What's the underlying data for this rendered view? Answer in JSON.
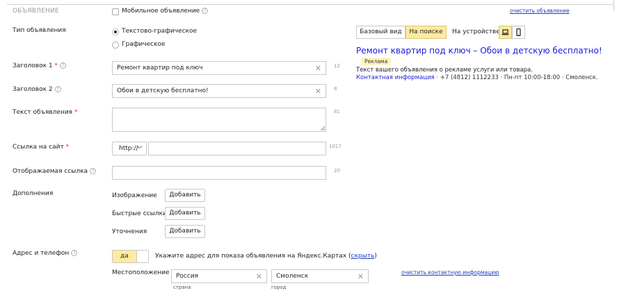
{
  "section": {
    "title": "ОБЪЯВЛЕНИЕ",
    "mobile_label": "Мобильное объявление",
    "mobile_checked": false,
    "clear_ad_link": "очистить объявление"
  },
  "ad_type": {
    "label": "Тип объявления",
    "options": [
      {
        "label": "Текстово-графическое",
        "selected": true
      },
      {
        "label": "Графическое",
        "selected": false
      }
    ]
  },
  "title1": {
    "label": "Заголовок 1",
    "value": "Ремонт квартир под ключ",
    "counter": "12"
  },
  "title2": {
    "label": "Заголовок 2",
    "value": "Обои в детскую бесплатно!",
    "counter": "8"
  },
  "ad_text": {
    "label": "Текст объявления",
    "value": "",
    "counter": "81"
  },
  "site_link": {
    "label": "Ссылка на сайт",
    "protocol": "http://",
    "value": "",
    "counter": "1017"
  },
  "display_link": {
    "label": "Отображаемая ссылка",
    "value": "",
    "counter": "20"
  },
  "extras": {
    "label": "Дополнения",
    "items": [
      {
        "label": "Изображение",
        "button": "Добавить"
      },
      {
        "label": "Быстрые ссылки",
        "button": "Добавить"
      },
      {
        "label": "Уточнения",
        "button": "Добавить"
      }
    ]
  },
  "address": {
    "label": "Адрес и телефон",
    "toggle_label": "да",
    "hint_text": "Укажите адрес для показа объявления на Яндекс.Картах",
    "hint_paren_open": "(",
    "hide_link": "скрыть",
    "hint_paren_close": ")",
    "location_label": "Местоположение",
    "country_value": "Россия",
    "country_caption": "страна",
    "city_value": "Смоленск",
    "city_caption": "город",
    "clear_contact_link": "очистить контактную информацию"
  },
  "preview": {
    "tabs": [
      {
        "label": "Базовый вид",
        "active": false
      },
      {
        "label": "На поиске",
        "active": true
      }
    ],
    "device_label": "На устройстве",
    "devices": [
      {
        "icon": "laptop-icon",
        "active": true
      },
      {
        "icon": "mobile-icon",
        "active": false
      }
    ],
    "ad_title": "Ремонт квартир под ключ – Обои в детскую бесплатно!",
    "badge": "Реклама",
    "ad_text": "Текст вашего объявления о рекламе услуги или товара.",
    "contact_info": "Контактная информация",
    "phone": "· +7 (4812) 1112233",
    "hours": "· Пн-пт 10:00-18:00",
    "city": "· Смоленск."
  },
  "colors": {
    "accent_yellow": "#ffeba0",
    "link_blue": "#1a3dc1",
    "ad_title_blue": "#1a1adb",
    "required_red": "#e03030"
  }
}
